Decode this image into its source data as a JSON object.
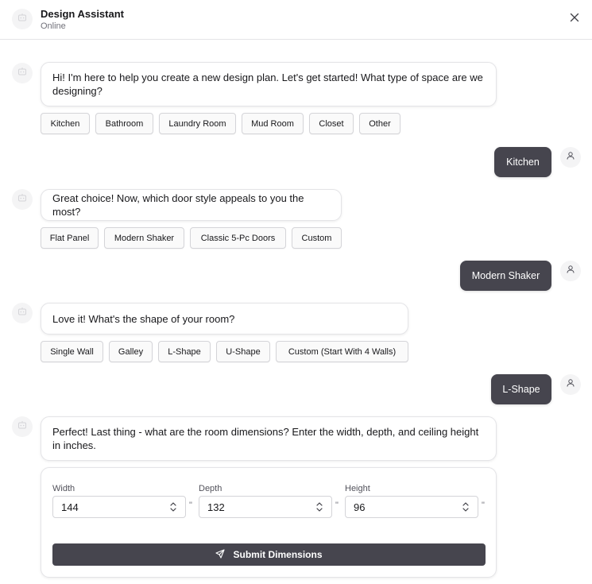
{
  "header": {
    "title": "Design Assistant",
    "status": "Online",
    "avatar_icon": "bot-icon",
    "close_icon": "close-icon"
  },
  "messages": {
    "m1": {
      "text": "Hi! I'm here to help you create a new design plan. Let's get started! What type of space are we designing?",
      "options": [
        "Kitchen",
        "Bathroom",
        "Laundry Room",
        "Mud Room",
        "Closet",
        "Other"
      ]
    },
    "u1": {
      "text": "Kitchen"
    },
    "m2": {
      "text": "Great choice! Now, which door style appeals to you the most?",
      "options": [
        "Flat Panel",
        "Modern Shaker",
        "Classic 5-Pc Doors",
        "Custom"
      ]
    },
    "u2": {
      "text": "Modern Shaker"
    },
    "m3": {
      "text": "Love it! What's the shape of your room?",
      "options": [
        "Single Wall",
        "Galley",
        "L-Shape",
        "U-Shape",
        "Custom (Start With 4 Walls)"
      ]
    },
    "u3": {
      "text": "L-Shape"
    },
    "m4": {
      "text": "Perfect! Last thing - what are the room dimensions? Enter the width, depth, and ceiling height in inches."
    }
  },
  "dimensions": {
    "fields": [
      {
        "label": "Width",
        "value": "144",
        "unit": "\""
      },
      {
        "label": "Depth",
        "value": "132",
        "unit": "\""
      },
      {
        "label": "Height",
        "value": "96",
        "unit": "\""
      }
    ],
    "submit_label": "Submit Dimensions"
  },
  "colors": {
    "user_bubble": "#46454e",
    "border": "#e4e4e7",
    "muted_text": "#71717a"
  }
}
